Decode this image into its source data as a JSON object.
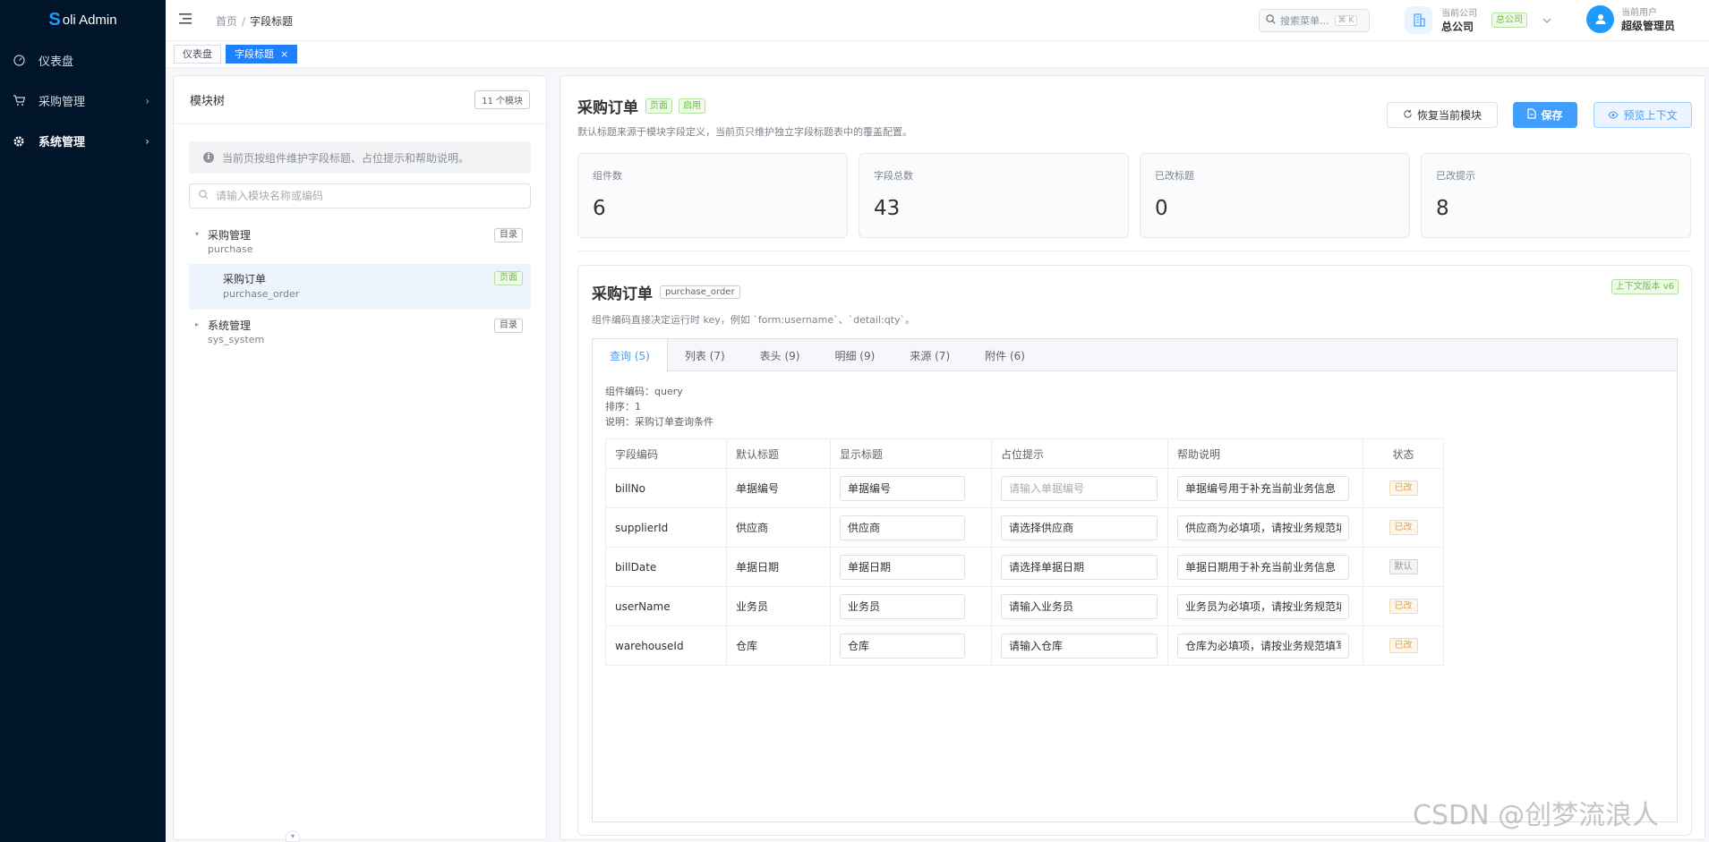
{
  "app": {
    "logo_mark": "S",
    "logo_text": "oli Admin"
  },
  "sidebar": {
    "items": [
      {
        "label": "仪表盘",
        "icon": "dashboard-icon"
      },
      {
        "label": "采购管理",
        "icon": "cart-icon"
      },
      {
        "label": "系统管理",
        "icon": "gear-icon"
      }
    ]
  },
  "header": {
    "breadcrumb": {
      "home": "首页",
      "sep": "/",
      "current": "字段标题"
    },
    "search": {
      "placeholder": "搜索菜单...",
      "shortcut": "⌘ K"
    },
    "company": {
      "label": "当前公司",
      "value": "总公司",
      "tag": "总公司"
    },
    "user": {
      "label": "当前用户",
      "value": "超级管理员"
    }
  },
  "page_tabs": [
    {
      "label": "仪表盘"
    },
    {
      "label": "字段标题",
      "close": "×"
    }
  ],
  "left": {
    "title": "模块树",
    "count": "11 个模块",
    "info": "当前页按组件维护字段标题、占位提示和帮助说明。",
    "search_placeholder": "请输入模块名称或编码",
    "tree": [
      {
        "name": "采购管理",
        "code": "purchase",
        "tag": "目录",
        "toggle": "▾"
      },
      {
        "name": "采购订单",
        "code": "purchase_order",
        "tag": "页面"
      },
      {
        "name": "系统管理",
        "code": "sys_system",
        "tag": "目录",
        "toggle": "▸"
      }
    ]
  },
  "main": {
    "title": "采购订单",
    "tag_page": "页面",
    "tag_enabled": "启用",
    "subtitle": "默认标题来源于模块字段定义，当前页只维护独立字段标题表中的覆盖配置。",
    "buttons": {
      "restore": "恢复当前模块",
      "save": "保存",
      "preview": "预览上下文"
    },
    "stats": [
      {
        "label": "组件数",
        "value": "6"
      },
      {
        "label": "字段总数",
        "value": "43"
      },
      {
        "label": "已改标题",
        "value": "0"
      },
      {
        "label": "已改提示",
        "value": "8"
      }
    ],
    "card": {
      "title": "采购订单",
      "code": "purchase_order",
      "subtitle": "组件编码直接决定运行时 key，例如 `form:username`、`detail:qty`。",
      "version": "上下文版本 v6",
      "tabs": [
        {
          "label": "查询 (5)"
        },
        {
          "label": "列表 (7)"
        },
        {
          "label": "表头 (9)"
        },
        {
          "label": "明细 (9)"
        },
        {
          "label": "来源 (7)"
        },
        {
          "label": "附件 (6)"
        }
      ],
      "meta": {
        "code": "组件编码：query",
        "order": "排序：1",
        "desc": "说明：采购订单查询条件"
      },
      "columns": [
        "字段编码",
        "默认标题",
        "显示标题",
        "占位提示",
        "帮助说明",
        "状态"
      ],
      "rows": [
        {
          "code": "billNo",
          "default": "单据编号",
          "display": "单据编号",
          "placeholder": "",
          "placeholder_hint": "请输入单据编号",
          "help": "单据编号用于补充当前业务信息",
          "status": "已改",
          "status_type": "changed"
        },
        {
          "code": "supplierId",
          "default": "供应商",
          "display": "供应商",
          "placeholder": "请选择供应商",
          "placeholder_hint": "",
          "help": "供应商为必填项，请按业务规范填写",
          "status": "已改",
          "status_type": "changed"
        },
        {
          "code": "billDate",
          "default": "单据日期",
          "display": "单据日期",
          "placeholder": "请选择单据日期",
          "placeholder_hint": "",
          "help": "单据日期用于补充当前业务信息",
          "status": "默认",
          "status_type": "default"
        },
        {
          "code": "userName",
          "default": "业务员",
          "display": "业务员",
          "placeholder": "请输入业务员",
          "placeholder_hint": "",
          "help": "业务员为必填项，请按业务规范填写",
          "status": "已改",
          "status_type": "changed"
        },
        {
          "code": "warehouseId",
          "default": "仓库",
          "display": "仓库",
          "placeholder": "请输入仓库",
          "placeholder_hint": "",
          "help": "仓库为必填项，请按业务规范填写",
          "status": "已改",
          "status_type": "changed"
        }
      ]
    }
  },
  "watermark": "CSDN @创梦流浪人"
}
